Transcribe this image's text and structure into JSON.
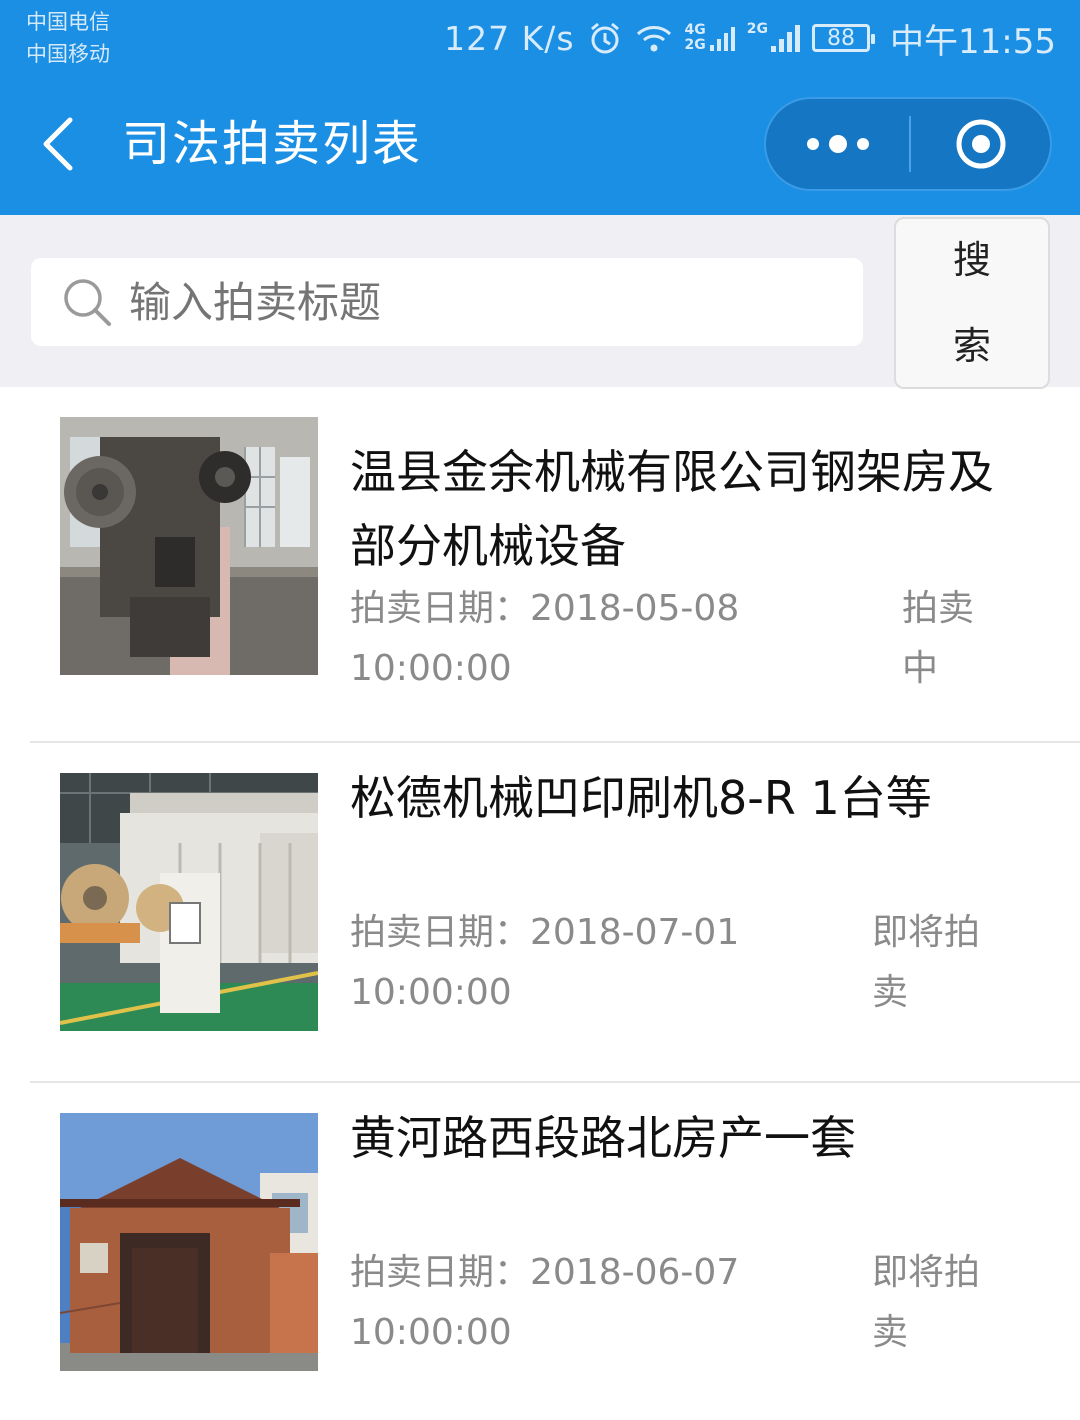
{
  "status_bar": {
    "carrier_1": "中国电信",
    "carrier_2": "中国移动",
    "speed": "127 K/s",
    "net_top": "4G",
    "net_bottom": "2G",
    "net_2": "2G",
    "battery": "88",
    "time": "中午11:55"
  },
  "nav": {
    "title": "司法拍卖列表",
    "back_icon": "chevron-left-icon",
    "more_icon": "more-dots-icon",
    "close_icon": "target-circle-icon"
  },
  "search": {
    "placeholder": "输入拍卖标题",
    "button_label": "搜索"
  },
  "colors": {
    "header": "#1a8fe3",
    "search_bg": "#efeff4",
    "text_primary": "#111111",
    "text_secondary": "#8a8a8a"
  },
  "auctions": [
    {
      "title": "温县金余机械有限公司钢架房及部分机械设备",
      "date_label": "拍卖日期：",
      "date": "2018-05-08",
      "time": "10:00:00",
      "status": "拍卖中",
      "image": "punch-press-machine"
    },
    {
      "title": "松德机械凹印刷机8-R 1台等",
      "date_label": "拍卖日期：",
      "date": "2018-07-01",
      "time": "10:00:00",
      "status": "即将拍卖",
      "image": "gravure-printing-machine"
    },
    {
      "title": "黄河路西段路北房产一套",
      "date_label": "拍卖日期：",
      "date": "2018-06-07",
      "time": "10:00:00",
      "status": "即将拍卖",
      "image": "brick-house"
    }
  ]
}
